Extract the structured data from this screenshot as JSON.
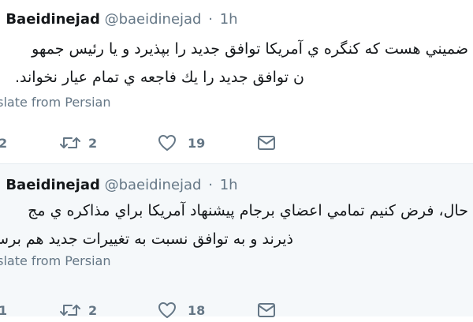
{
  "tweets": [
    {
      "author_name": "id Baeidinejad",
      "handle": "@baeidinejad",
      "separator": "·",
      "time": "1h",
      "body_lines": [
        "ضميني هست كه كنگره ي آمريكا توافق جديد را بپذيرد و يا رئيس جمهو",
        "ن توافق جديد را يك فاجعه ي تمام عيار نخواند."
      ],
      "translate_label": "nslate from Persian",
      "reply_count": "2",
      "retweet_count": "2",
      "like_count": "19"
    },
    {
      "author_name": "id Baeidinejad",
      "handle": "@baeidinejad",
      "separator": "·",
      "time": "1h",
      "body_lines": [
        "حال، فرض كنيم تمامي اعضاي برجام پيشنهاد آمريكا براي مذاكره ي مج",
        "ذيرند و به توافق نسبت به تغييرات جديد هم برسند."
      ],
      "translate_label": "nslate from Persian",
      "reply_count": "1",
      "retweet_count": "2",
      "like_count": "18"
    }
  ],
  "icons": {
    "retweet": "retweet-icon",
    "like": "heart-icon",
    "dm": "envelope-icon"
  }
}
